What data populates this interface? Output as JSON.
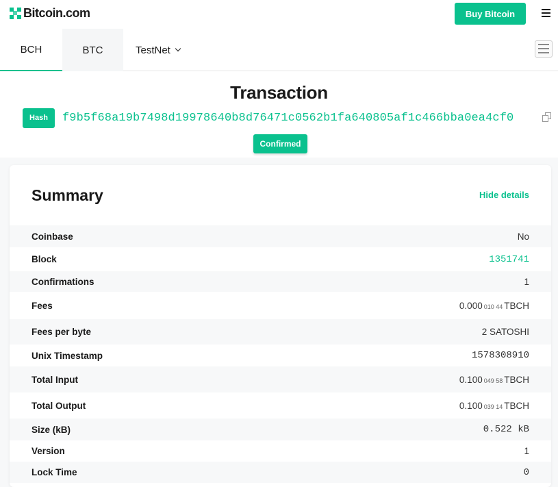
{
  "header": {
    "logo_text": "Bitcoin.com",
    "buy_label": "Buy Bitcoin"
  },
  "tabs": [
    {
      "label": "BCH",
      "active": true
    },
    {
      "label": "BTC",
      "active": false
    },
    {
      "label": "TestNet",
      "active": false
    }
  ],
  "page": {
    "title": "Transaction",
    "hash_label": "Hash",
    "hash_value": "f9b5f68a19b7498d19978640b8d76471c0562b1fa640805af1c466bba0ea4cf0",
    "status": "Confirmed"
  },
  "summary": {
    "title": "Summary",
    "toggle_label": "Hide details",
    "rows": [
      {
        "label": "Coinbase",
        "value": "No"
      },
      {
        "label": "Block",
        "value": "1351741"
      },
      {
        "label": "Confirmations",
        "value": "1"
      },
      {
        "label": "Fees",
        "value_main": "0.000",
        "value_small": "010 44",
        "unit": "TBCH"
      },
      {
        "label": "Fees per byte",
        "value": "2 SATOSHI"
      },
      {
        "label": "Unix Timestamp",
        "value": "1578308910"
      },
      {
        "label": "Total Input",
        "value_main": "0.100",
        "value_small": "049 58",
        "unit": "TBCH"
      },
      {
        "label": "Total Output",
        "value_main": "0.100",
        "value_small": "039 14",
        "unit": "TBCH"
      },
      {
        "label": "Size (kB)",
        "value": "0.522 kB"
      },
      {
        "label": "Version",
        "value": "1"
      },
      {
        "label": "Lock Time",
        "value": "0"
      }
    ]
  },
  "colors": {
    "accent": "#0ac18e",
    "text": "#1a1a1a",
    "stripe": "#f7f8f9"
  },
  "icons": [
    "bitcoin-com-logo-icon",
    "hamburger-menu-icon",
    "chevron-down-icon",
    "sidebar-menu-icon",
    "copy-icon"
  ]
}
